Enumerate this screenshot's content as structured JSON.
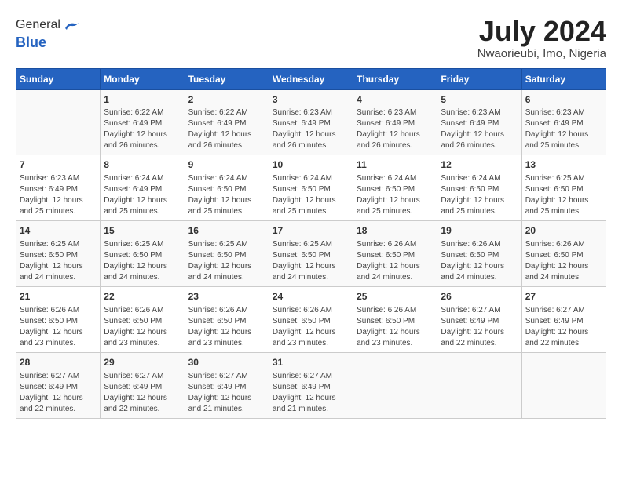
{
  "header": {
    "logo_line1": "General",
    "logo_line2": "Blue",
    "month_title": "July 2024",
    "location": "Nwaorieubi, Imo, Nigeria"
  },
  "days_of_week": [
    "Sunday",
    "Monday",
    "Tuesday",
    "Wednesday",
    "Thursday",
    "Friday",
    "Saturday"
  ],
  "weeks": [
    [
      {
        "day": "",
        "info": ""
      },
      {
        "day": "1",
        "info": "Sunrise: 6:22 AM\nSunset: 6:49 PM\nDaylight: 12 hours\nand 26 minutes."
      },
      {
        "day": "2",
        "info": "Sunrise: 6:22 AM\nSunset: 6:49 PM\nDaylight: 12 hours\nand 26 minutes."
      },
      {
        "day": "3",
        "info": "Sunrise: 6:23 AM\nSunset: 6:49 PM\nDaylight: 12 hours\nand 26 minutes."
      },
      {
        "day": "4",
        "info": "Sunrise: 6:23 AM\nSunset: 6:49 PM\nDaylight: 12 hours\nand 26 minutes."
      },
      {
        "day": "5",
        "info": "Sunrise: 6:23 AM\nSunset: 6:49 PM\nDaylight: 12 hours\nand 26 minutes."
      },
      {
        "day": "6",
        "info": "Sunrise: 6:23 AM\nSunset: 6:49 PM\nDaylight: 12 hours\nand 25 minutes."
      }
    ],
    [
      {
        "day": "7",
        "info": "Sunrise: 6:23 AM\nSunset: 6:49 PM\nDaylight: 12 hours\nand 25 minutes."
      },
      {
        "day": "8",
        "info": "Sunrise: 6:24 AM\nSunset: 6:49 PM\nDaylight: 12 hours\nand 25 minutes."
      },
      {
        "day": "9",
        "info": "Sunrise: 6:24 AM\nSunset: 6:50 PM\nDaylight: 12 hours\nand 25 minutes."
      },
      {
        "day": "10",
        "info": "Sunrise: 6:24 AM\nSunset: 6:50 PM\nDaylight: 12 hours\nand 25 minutes."
      },
      {
        "day": "11",
        "info": "Sunrise: 6:24 AM\nSunset: 6:50 PM\nDaylight: 12 hours\nand 25 minutes."
      },
      {
        "day": "12",
        "info": "Sunrise: 6:24 AM\nSunset: 6:50 PM\nDaylight: 12 hours\nand 25 minutes."
      },
      {
        "day": "13",
        "info": "Sunrise: 6:25 AM\nSunset: 6:50 PM\nDaylight: 12 hours\nand 25 minutes."
      }
    ],
    [
      {
        "day": "14",
        "info": "Sunrise: 6:25 AM\nSunset: 6:50 PM\nDaylight: 12 hours\nand 24 minutes."
      },
      {
        "day": "15",
        "info": "Sunrise: 6:25 AM\nSunset: 6:50 PM\nDaylight: 12 hours\nand 24 minutes."
      },
      {
        "day": "16",
        "info": "Sunrise: 6:25 AM\nSunset: 6:50 PM\nDaylight: 12 hours\nand 24 minutes."
      },
      {
        "day": "17",
        "info": "Sunrise: 6:25 AM\nSunset: 6:50 PM\nDaylight: 12 hours\nand 24 minutes."
      },
      {
        "day": "18",
        "info": "Sunrise: 6:26 AM\nSunset: 6:50 PM\nDaylight: 12 hours\nand 24 minutes."
      },
      {
        "day": "19",
        "info": "Sunrise: 6:26 AM\nSunset: 6:50 PM\nDaylight: 12 hours\nand 24 minutes."
      },
      {
        "day": "20",
        "info": "Sunrise: 6:26 AM\nSunset: 6:50 PM\nDaylight: 12 hours\nand 24 minutes."
      }
    ],
    [
      {
        "day": "21",
        "info": "Sunrise: 6:26 AM\nSunset: 6:50 PM\nDaylight: 12 hours\nand 23 minutes."
      },
      {
        "day": "22",
        "info": "Sunrise: 6:26 AM\nSunset: 6:50 PM\nDaylight: 12 hours\nand 23 minutes."
      },
      {
        "day": "23",
        "info": "Sunrise: 6:26 AM\nSunset: 6:50 PM\nDaylight: 12 hours\nand 23 minutes."
      },
      {
        "day": "24",
        "info": "Sunrise: 6:26 AM\nSunset: 6:50 PM\nDaylight: 12 hours\nand 23 minutes."
      },
      {
        "day": "25",
        "info": "Sunrise: 6:26 AM\nSunset: 6:50 PM\nDaylight: 12 hours\nand 23 minutes."
      },
      {
        "day": "26",
        "info": "Sunrise: 6:27 AM\nSunset: 6:49 PM\nDaylight: 12 hours\nand 22 minutes."
      },
      {
        "day": "27",
        "info": "Sunrise: 6:27 AM\nSunset: 6:49 PM\nDaylight: 12 hours\nand 22 minutes."
      }
    ],
    [
      {
        "day": "28",
        "info": "Sunrise: 6:27 AM\nSunset: 6:49 PM\nDaylight: 12 hours\nand 22 minutes."
      },
      {
        "day": "29",
        "info": "Sunrise: 6:27 AM\nSunset: 6:49 PM\nDaylight: 12 hours\nand 22 minutes."
      },
      {
        "day": "30",
        "info": "Sunrise: 6:27 AM\nSunset: 6:49 PM\nDaylight: 12 hours\nand 21 minutes."
      },
      {
        "day": "31",
        "info": "Sunrise: 6:27 AM\nSunset: 6:49 PM\nDaylight: 12 hours\nand 21 minutes."
      },
      {
        "day": "",
        "info": ""
      },
      {
        "day": "",
        "info": ""
      },
      {
        "day": "",
        "info": ""
      }
    ]
  ]
}
